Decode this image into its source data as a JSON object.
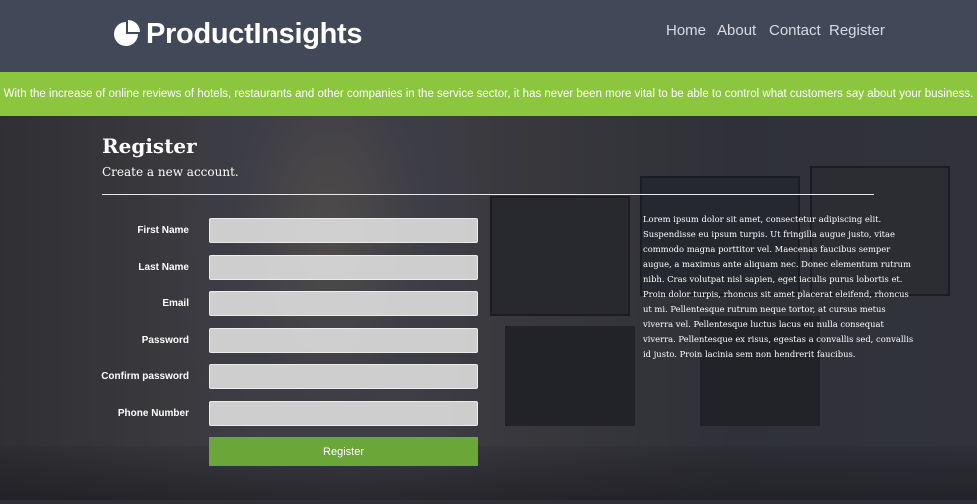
{
  "brand": {
    "name": "ProductInsights"
  },
  "nav": {
    "items": [
      {
        "label": "Home"
      },
      {
        "label": "About"
      },
      {
        "label": "Contact"
      },
      {
        "label": "Register"
      }
    ]
  },
  "banner": {
    "text": "With the increase of online reviews of hotels, restaurants and other companies in the service sector, it has never been more vital to be able to control what customers say about your business."
  },
  "form": {
    "title": "Register",
    "subtitle": "Create a new account.",
    "fields": [
      {
        "label": "First Name",
        "value": ""
      },
      {
        "label": "Last Name",
        "value": ""
      },
      {
        "label": "Email",
        "value": ""
      },
      {
        "label": "Password",
        "value": ""
      },
      {
        "label": "Confirm password",
        "value": ""
      },
      {
        "label": "Phone Number",
        "value": ""
      }
    ],
    "submit_label": "Register"
  },
  "aside": {
    "text": "Lorem ipsum dolor sit amet, consectetur adipiscing elit. Suspendisse eu ipsum turpis. Ut fringilla augue justo, vitae commodo magna porttitor vel. Maecenas faucibus semper augue, a maximus ante aliquam nec. Donec elementum rutrum nibh. Cras volutpat nisl sapien, eget iaculis purus lobortis et. Proin dolor turpis, rhoncus sit amet placerat eleifend, rhoncus ut mi. Pellentesque rutrum neque tortor, at cursus metus viverra vel. Pellentesque luctus lacus eu nulla consequat viverra. Pellentesque ex risus, egestas a convallis sed, convallis id justo. Proin lacinia sem non hendrerit faucibus."
  },
  "colors": {
    "header": "#414858",
    "banner": "#8cc63f",
    "button": "#6aa638",
    "text": "#ffffff"
  },
  "icons": {
    "logo": "pie-chart-icon"
  }
}
